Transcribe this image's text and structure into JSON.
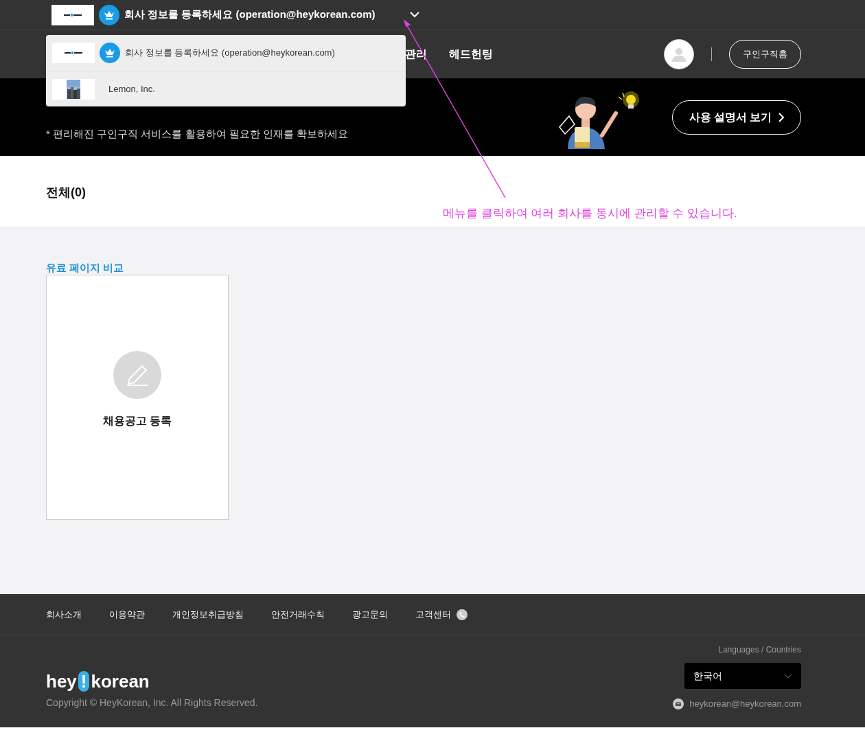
{
  "account_bar": {
    "current": "회사 정보를 등록하세요 (operation@heykorean.com)",
    "expanded": true
  },
  "account_menu": [
    {
      "kind": "crown",
      "label": "회사 정보를 등록하세요 (operation@heykorean.com)"
    },
    {
      "label": "Lemon, Inc."
    }
  ],
  "nav": [
    "관리",
    "헤드헌팅"
  ],
  "header_button": "구인구직홈",
  "banner": {
    "subtitle": "* 편리해진 구인구직 서비스를 활용하여 필요한 인재를 확보하세요",
    "button": "사용 설명서 보기"
  },
  "annotation": "메뉴를 클릭하여 여러 회사를 동시에 관리할 수 있습니다.",
  "summary": "전체(0)",
  "compare_link": "유료 페이지 비교",
  "new_post_card": "채용공고 등록",
  "footer": {
    "links": [
      "회사소개",
      "이용약관",
      "개인정보취급방침",
      "안전거래수칙",
      "광고문의",
      "고객센터"
    ],
    "logo": {
      "left": "hey",
      "mark": "!",
      "right": "korean"
    },
    "copyright": "Copyright © HeyKorean, Inc. All Rights Reserved.",
    "language_label": "Languages / Countries",
    "language": "한국어",
    "email": "heykorean@heykorean.com"
  }
}
